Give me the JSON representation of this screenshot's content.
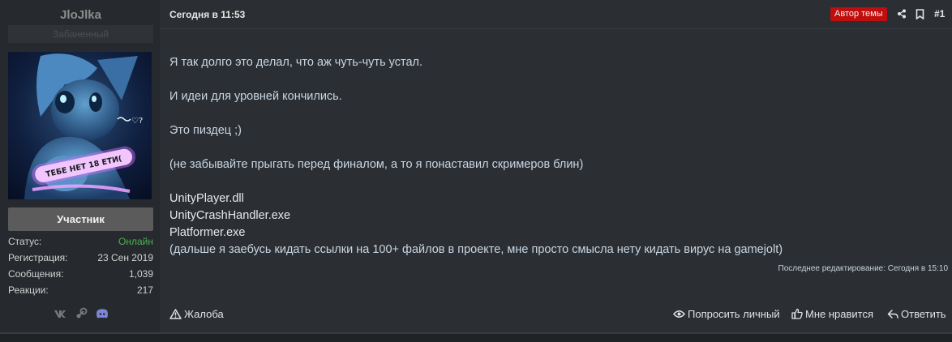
{
  "user": {
    "username": "JloJlka",
    "ban_status": "Забаненный",
    "role": "Участник",
    "stats": [
      {
        "label": "Статус:",
        "value": "Онлайн"
      },
      {
        "label": "Регистрация:",
        "value": "23 Сен 2019"
      },
      {
        "label": "Сообщения:",
        "value": "1,039"
      },
      {
        "label": "Реакции:",
        "value": "217"
      }
    ],
    "avatar_caption": "ТЕБЕ НЕТ 18 ЕТИ(",
    "social_icons": [
      "vk-icon",
      "steam-icon",
      "discord-icon"
    ]
  },
  "post": {
    "date": "Сегодня в 11:53",
    "author_badge": "Автор темы",
    "number": "#1",
    "lines": {
      "l1": "Я так долго это делал, что аж чуть-чуть устал.",
      "l2": "И идеи для уровней кончились.",
      "l3": "Это пиздец ;)",
      "l4": "(не забывайте прыгать перед финалом, а то я понаставил скримеров блин)",
      "f1": "UnityPlayer.dll",
      "f2": "UnityCrashHandler.exe",
      "f3": "Platformer.exe",
      "l5": "(дальше я заебусь кидать ссылки на 100+ файлов в проекте, мне просто смысла нету кидать вирус на gamejolt)"
    },
    "edited": "Последнее редактирование: Сегодня в 15:10"
  },
  "footer": {
    "report": "Жалоба",
    "ask_private": "Попросить личный",
    "like": "Мне нравится",
    "reply": "Ответить"
  },
  "colors": {
    "badge_red": "#c00d0d",
    "online_green": "#4caf50",
    "role_gray": "#5b5b5b",
    "panel_bg": "#262a2e",
    "post_bg": "#2b2f33"
  }
}
